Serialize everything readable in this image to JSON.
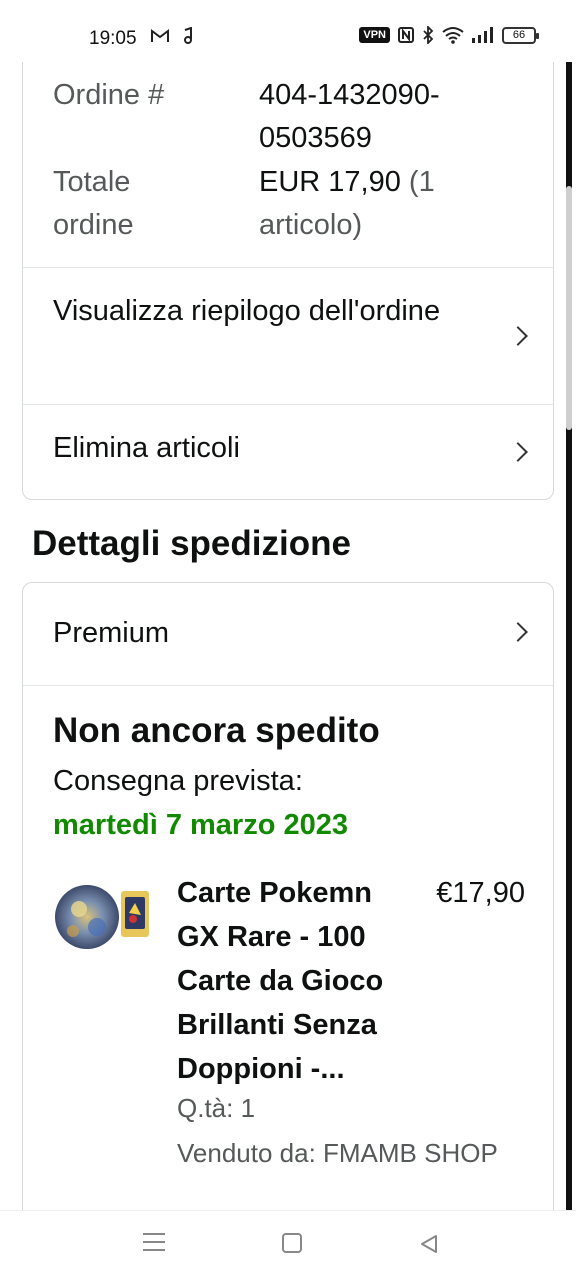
{
  "status_bar": {
    "time": "19:05",
    "vpn": "VPN",
    "battery": "66"
  },
  "order_card": {
    "order_label": "Ordine #",
    "order_value": "404-1432090-0503569",
    "total_label": "Totale ordine",
    "total_value": "EUR 17,90",
    "total_items": "(1 articolo)",
    "view_summary_label": "Visualizza riepilogo dell'ordine",
    "delete_items_label": "Elimina articoli"
  },
  "shipping": {
    "section_title": "Dettagli spedizione",
    "shipping_type": "Premium",
    "status": "Non ancora spedito",
    "delivery_label": "Consegna prevista:",
    "delivery_date": "martedì 7 marzo 2023"
  },
  "product": {
    "title": "Carte Pokemn GX Rare - 100 Carte da Gioco Brillanti Senza Doppioni -...",
    "price": "€17,90",
    "quantity": "Q.tà: 1",
    "seller": "Venduto da: FMAMB SHOP"
  },
  "colors": {
    "delivery_date": "#118a00",
    "muted_text": "#565959",
    "border": "#d5d9d9"
  },
  "icons": {
    "notification_gmail": "gmail-icon",
    "notification_music": "music-note-icon",
    "nfc": "nfc-icon",
    "bluetooth": "bluetooth-icon",
    "wifi": "wifi-icon",
    "signal": "signal-icon",
    "chevron": "chevron-right-icon",
    "nav_menu": "menu-icon",
    "nav_home": "home-icon",
    "nav_back": "back-icon"
  }
}
